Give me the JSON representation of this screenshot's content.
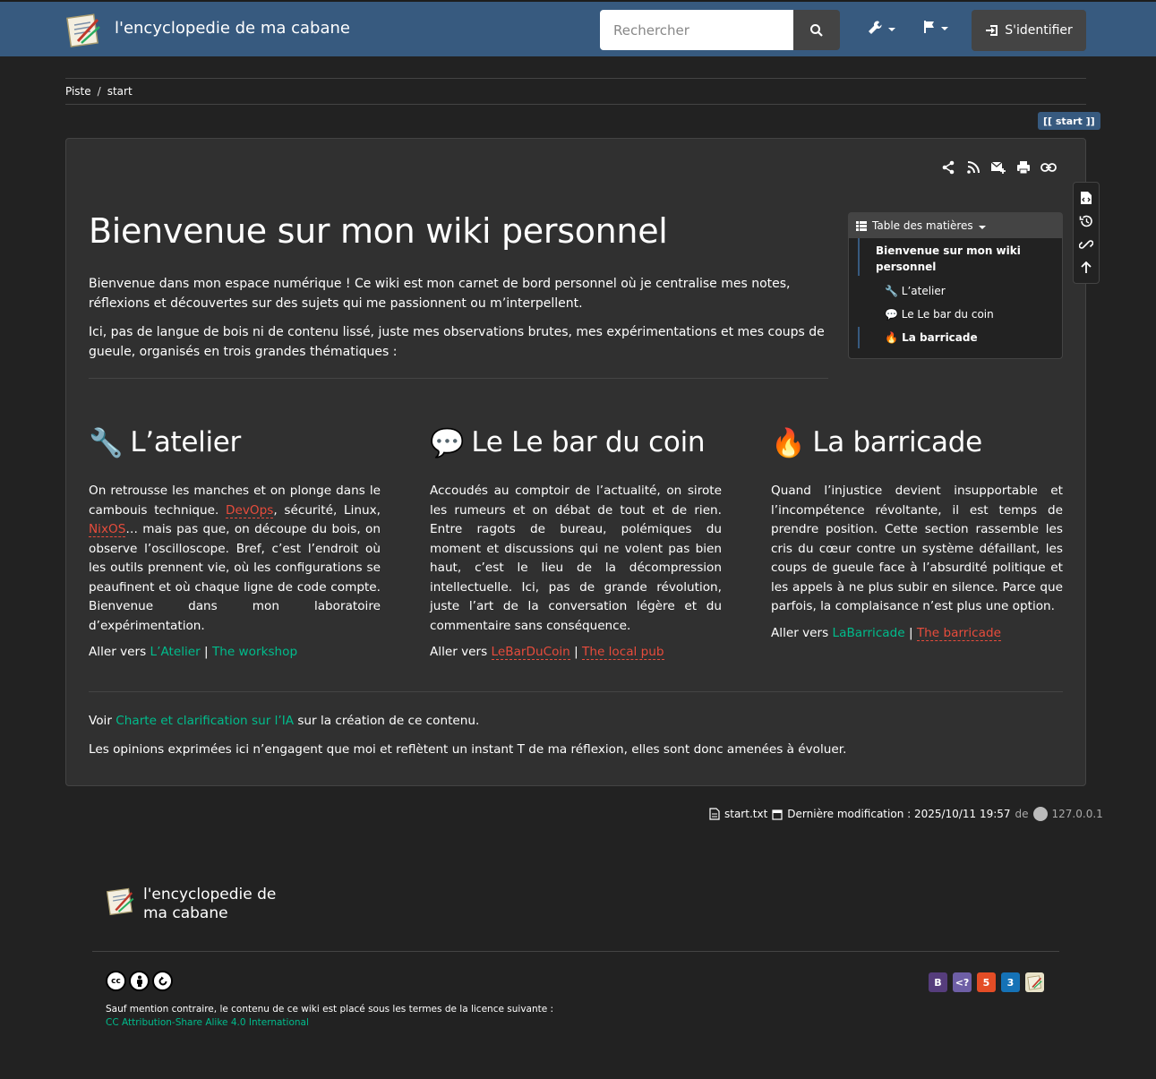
{
  "header": {
    "site_title": "l'encyclopedie de ma cabane",
    "search_placeholder": "Rechercher",
    "login_label": "S'identifier"
  },
  "breadcrumb": {
    "items": [
      "Piste",
      "start"
    ],
    "separator": "/"
  },
  "page_badge": "[[ start ]]",
  "page": {
    "title": "Bienvenue sur mon wiki personnel",
    "intro": [
      "Bienvenue dans mon espace numérique ! Ce wiki est mon carnet de bord personnel où je centralise mes notes, réflexions et découvertes sur des sujets qui me passionnent ou m’interpellent.",
      "Ici, pas de langue de bois ni de contenu lissé, juste mes observations brutes, mes expérimentations et mes coups de gueule, organisés en trois grandes thématiques :"
    ]
  },
  "toc": {
    "title": "Table des matières",
    "items": [
      {
        "label": "Bienvenue sur mon wiki personnel",
        "level": 1
      },
      {
        "label": "🔧 L’atelier",
        "level": 2
      },
      {
        "label": "💬 Le Le bar du coin",
        "level": 2
      },
      {
        "label": "🔥 La barricade",
        "level": 2
      }
    ]
  },
  "sections": [
    {
      "emoji": "🔧",
      "title": "L’atelier",
      "text_parts": [
        "On retrousse les manches et on plonge dans le cambouis technique. ",
        "DevOps",
        ", sécurité, Linux, ",
        "NixOS",
        "… mais pas que, on découpe du bois, on observe l’oscilloscope. Bref, c’est l’endroit où les outils prennent vie, où les configurations se peaufinent et où chaque ligne de code compte. Bienvenue dans mon laboratoire d’expérimentation."
      ],
      "goto_prefix": "Aller vers",
      "link1": "L’Atelier",
      "link2": "The workshop",
      "pipe": "|"
    },
    {
      "emoji": "💬",
      "title": "Le Le bar du coin",
      "text": "Accoudés au comptoir de l’actualité, on sirote les rumeurs et on débat de tout et de rien. Entre ragots de bureau, polémiques du moment et discussions qui ne volent pas bien haut, c’est le lieu de la décompression intellectuelle. Ici, pas de grande révolution, juste l’art de la conversation légère et du commentaire sans conséquence.",
      "goto_prefix": "Aller vers",
      "link1": "LeBarDuCoin",
      "link2": "The local pub",
      "pipe": "|"
    },
    {
      "emoji": "🔥",
      "title": "La barricade",
      "text": "Quand l’injustice devient insupportable et l’incompétence révoltante, il est temps de prendre position. Cette section rassemble les cris du cœur contre un système défaillant, les coups de gueule face à l’absurdité politique et les appels à ne plus subir en silence. Parce que parfois, la complaisance n’est plus une option.",
      "goto_prefix": "Aller vers",
      "link1": "LaBarricade",
      "link2": "The barricade",
      "pipe": "|"
    }
  ],
  "outro": {
    "line1_prefix": "Voir",
    "line1_link": "Charte et clarification sur l’IA",
    "line1_suffix": "sur la création de ce contenu.",
    "line2": "Les opinions exprimées ici n’engagent que moi et reflètent un instant T de ma réflexion, elles sont donc amenées à évoluer."
  },
  "docinfo": {
    "filename": "start.txt",
    "modified": "Dernière modification : 2025/10/11 19:57",
    "by": "de",
    "user": "127.0.0.1"
  },
  "footer": {
    "site_title": "l'encyclopedie de ma cabane",
    "license_intro": "Sauf mention contraire, le contenu de ce wiki est placé sous les termes de la licence suivante :",
    "license_link": "CC Attribution-Share Alike 4.0 International",
    "cc_icons": [
      "cc-icon",
      "by-icon",
      "sa-icon"
    ],
    "tech_badges": [
      {
        "name": "bootstrap-badge",
        "label": "B",
        "color": "#563d7c"
      },
      {
        "name": "php-badge",
        "label": "<?",
        "color": "#6e5fa6"
      },
      {
        "name": "html5-badge",
        "label": "5",
        "color": "#e44d26"
      },
      {
        "name": "css3-badge",
        "label": "3",
        "color": "#1572b6"
      },
      {
        "name": "dokuwiki-badge",
        "label": "",
        "color": "#e8e2c8"
      }
    ]
  },
  "colors": {
    "navbar": "#375a7f",
    "background": "#222222",
    "panel": "#303030",
    "link_existing": "#00bc8c",
    "link_missing": "#e74c3c"
  }
}
